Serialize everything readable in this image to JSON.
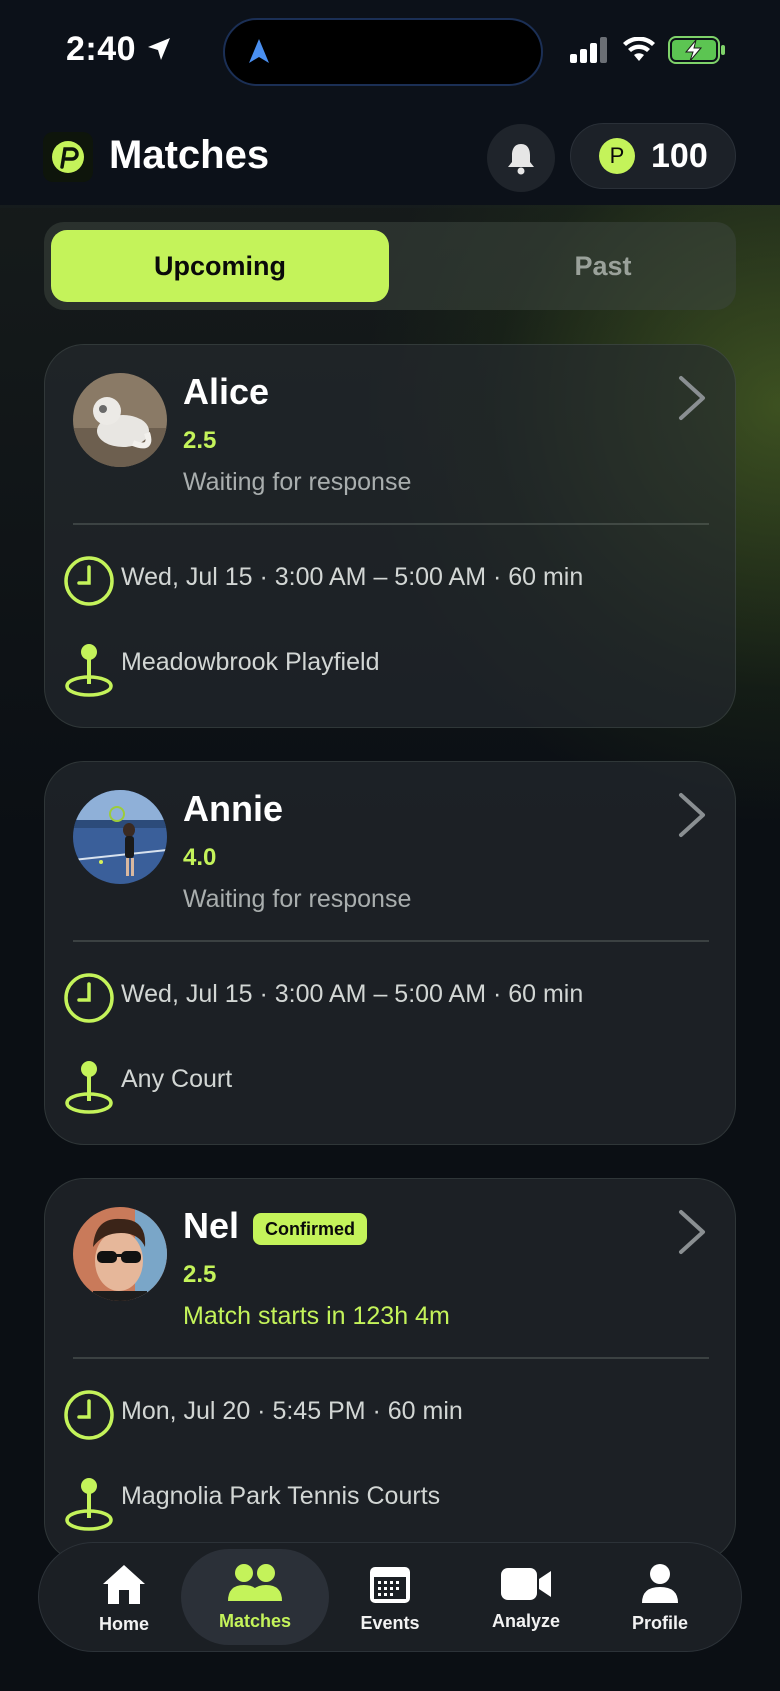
{
  "status_bar": {
    "time": "2:40"
  },
  "header": {
    "title": "Matches",
    "points": "100",
    "points_symbol": "P"
  },
  "segments": {
    "upcoming": "Upcoming",
    "past": "Past",
    "selected": "Upcoming"
  },
  "matches": [
    {
      "name": "Alice",
      "rating": "2.5",
      "status": "Waiting for response",
      "time": "Wed, Jul 15 · 3:00 AM – 5:00 AM · 60 min",
      "location": "Meadowbrook Playfield",
      "badge": ""
    },
    {
      "name": "Annie",
      "rating": "4.0",
      "status": "Waiting for response",
      "time": "Wed, Jul 15 · 3:00 AM – 5:00 AM · 60 min",
      "location": "Any Court",
      "badge": ""
    },
    {
      "name": "Nel",
      "rating": "2.5",
      "status": "Match starts in 123h 4m",
      "time": "Mon, Jul 20 · 5:45 PM · 60 min",
      "location": "Magnolia Park Tennis Courts",
      "badge": "Confirmed"
    }
  ],
  "tabbar": [
    {
      "label": "Home",
      "icon": "home-icon"
    },
    {
      "label": "Matches",
      "icon": "people-icon",
      "active": true
    },
    {
      "label": "Events",
      "icon": "calendar-icon"
    },
    {
      "label": "Analyze",
      "icon": "video-icon"
    },
    {
      "label": "Profile",
      "icon": "person-icon"
    }
  ],
  "colors": {
    "accent": "#c4f35a",
    "background": "#0b0f14",
    "card": "#262b30"
  }
}
